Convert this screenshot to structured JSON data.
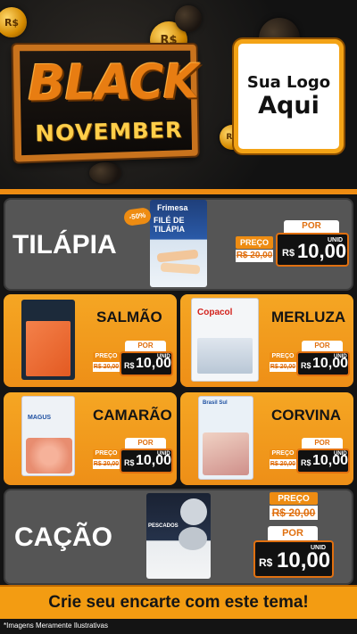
{
  "header": {
    "banner_line1": "BLACK",
    "banner_line2": "NOVEMBER",
    "coin_symbol": "R$",
    "logo_line1": "Sua Logo",
    "logo_line2": "Aqui"
  },
  "colors": {
    "accent": "#ee8c12",
    "dark_card": "#555555",
    "orange_card": "#f5a623",
    "background": "#141414"
  },
  "featured": {
    "name": "TILÁPIA",
    "discount_badge": "-50%",
    "package_brand": "Frimesa",
    "package_title": "FILÉ DE TILÁPIA",
    "price_label": "PREÇO",
    "old_price": "R$ 20,00",
    "por_label": "POR",
    "currency": "R$",
    "price": "10,00",
    "unit": "UNID"
  },
  "grid": [
    {
      "name": "SALMÃO",
      "price_label": "PREÇO",
      "old_price": "R$ 20,00",
      "por_label": "POR",
      "currency": "R$",
      "price": "10,00",
      "unit": "UNID"
    },
    {
      "name": "MERLUZA",
      "package_brand": "Copacol",
      "price_label": "PREÇO",
      "old_price": "R$ 20,00",
      "por_label": "POR",
      "currency": "R$",
      "price": "10,00",
      "unit": "UNID"
    },
    {
      "name": "CAMARÃO",
      "package_brand": "MAGUS",
      "price_label": "PREÇO",
      "old_price": "R$ 20,00",
      "por_label": "POR",
      "currency": "R$",
      "price": "10,00",
      "unit": "UNID"
    },
    {
      "name": "CORVINA",
      "package_brand": "Brasil Sul",
      "price_label": "PREÇO",
      "old_price": "R$ 20,00",
      "por_label": "POR",
      "currency": "R$",
      "price": "10,00",
      "unit": "UNID"
    }
  ],
  "bottom": {
    "name": "CAÇÃO",
    "package_title": "PESCADOS",
    "price_label": "PREÇO",
    "old_price": "R$ 20,00",
    "por_label": "POR",
    "currency": "R$",
    "price": "10,00",
    "unit": "UNID"
  },
  "cta_text": "Crie seu encarte com este tema!",
  "disclaimer": "*Imagens Meramente Ilustrativas"
}
